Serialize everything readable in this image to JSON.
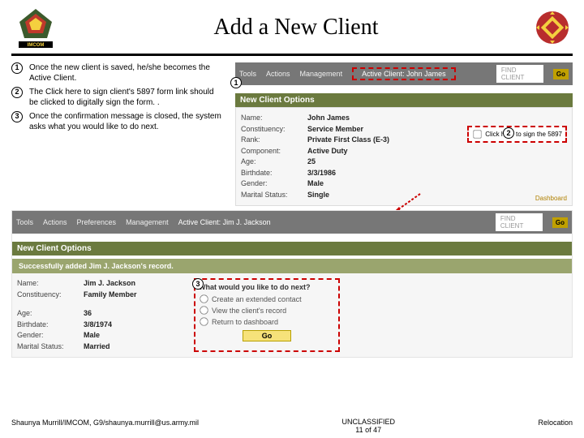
{
  "header": {
    "title": "Add a New Client"
  },
  "steps": {
    "s1": "Once the new client is saved, he/she becomes the Active Client.",
    "s2": "The Click here to sign client's 5897 form link should be clicked to digitally sign the form. .",
    "s3": "Once the confirmation message is closed, the system asks what you would like to do next."
  },
  "panel1": {
    "nav": {
      "tools": "Tools",
      "actions": "Actions",
      "management": "Management",
      "active": "Active Client: John James",
      "search_ph": "FIND CLIENT",
      "go": "Go"
    },
    "section": "New Client Options",
    "labels": {
      "name": "Name:",
      "constituency": "Constituency:",
      "rank": "Rank:",
      "component": "Component:",
      "age": "Age:",
      "birthdate": "Birthdate:",
      "gender": "Gender:",
      "marital": "Marital Status:"
    },
    "values": {
      "name": "John James",
      "constituency": "Service Member",
      "rank": "Private First Class (E-3)",
      "component": "Active Duty",
      "age": "25",
      "birthdate": "3/3/1986",
      "gender": "Male",
      "marital": "Single"
    },
    "sign": "Click here to sign the 5897"
  },
  "panel2": {
    "nav": {
      "tools": "Tools",
      "actions": "Actions",
      "preferences": "Preferences",
      "management": "Management",
      "active": "Active Client: Jim J. Jackson",
      "search_ph": "FIND CLIENT",
      "go": "Go"
    },
    "dashboard": "Dashboard",
    "section": "New Client Options",
    "success": "Successfully added Jim J. Jackson's record.",
    "labels": {
      "name": "Name:",
      "constituency": "Constituency:",
      "age": "Age:",
      "birthdate": "Birthdate:",
      "gender": "Gender:",
      "marital": "Marital Status:"
    },
    "values": {
      "name": "Jim J. Jackson",
      "constituency": "Family Member",
      "age": "36",
      "birthdate": "3/8/1974",
      "gender": "Male",
      "marital": "Married"
    },
    "next": {
      "q": "What would you like to do next?",
      "o1": "Create an extended contact",
      "o2": "View the client's record",
      "o3": "Return to dashboard",
      "go": "Go"
    }
  },
  "footer": {
    "left": "Shaunya Murrill/IMCOM, G9/shaunya.murrill@us.army.mil",
    "center1": "UNCLASSIFIED",
    "center2": "11 of 47",
    "right": "Relocation"
  }
}
